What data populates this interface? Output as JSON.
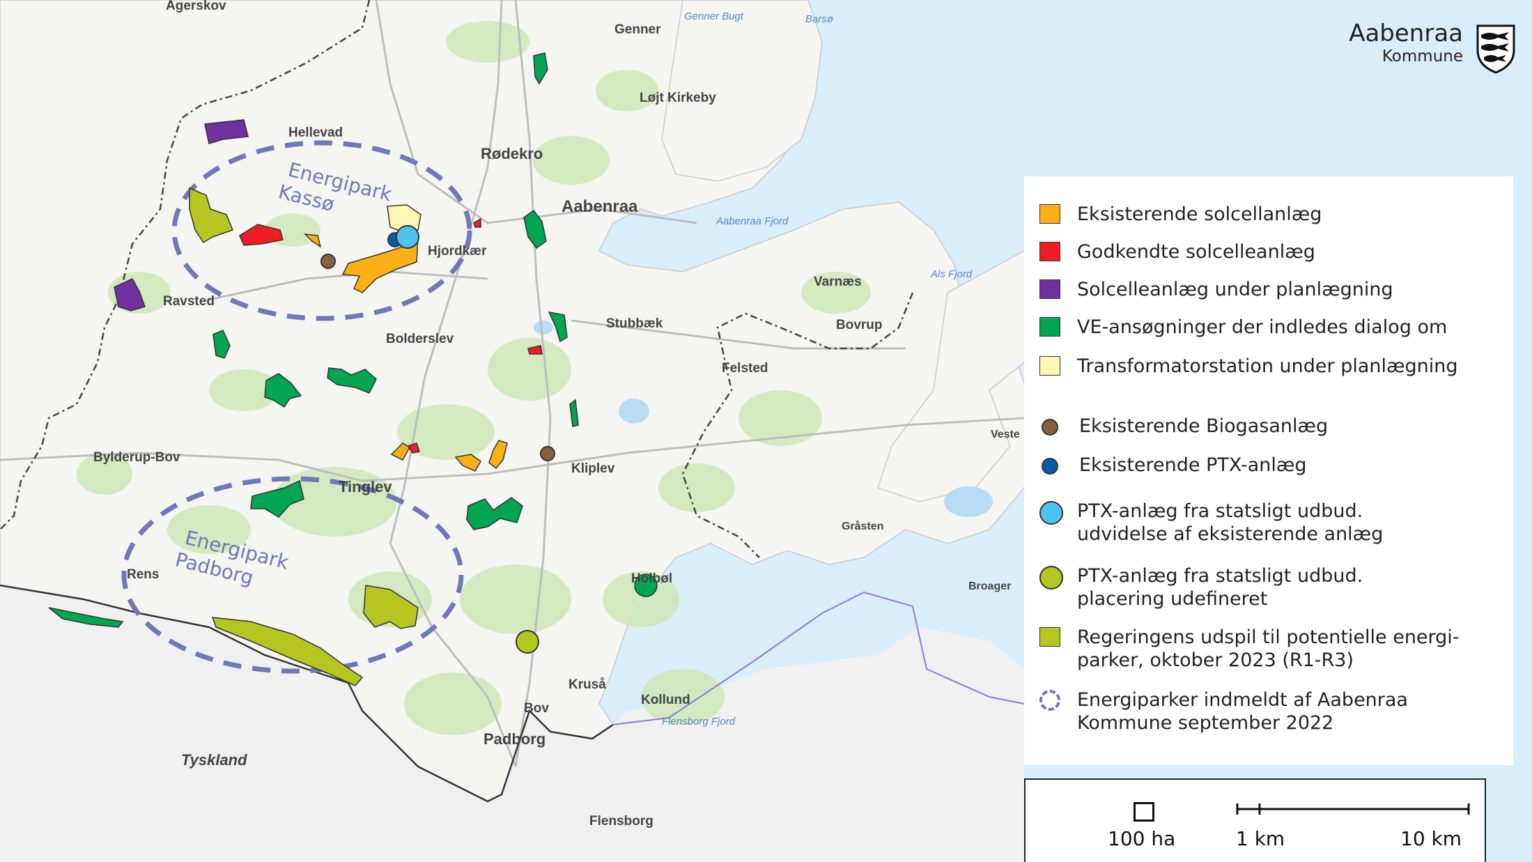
{
  "map": {
    "country_label": "Tyskland",
    "places": [
      {
        "id": "agerskov",
        "name": "Agerskov"
      },
      {
        "id": "genner",
        "name": "Genner"
      },
      {
        "id": "hellevad",
        "name": "Hellevad"
      },
      {
        "id": "rodekro",
        "name": "Rødekro"
      },
      {
        "id": "lojt",
        "name": "Løjt Kirkeby"
      },
      {
        "id": "aabenraa",
        "name": "Aabenraa"
      },
      {
        "id": "hjordkaer",
        "name": "Hjordkær"
      },
      {
        "id": "ravsted",
        "name": "Ravsted"
      },
      {
        "id": "boldersleu",
        "name": "Bolderslev"
      },
      {
        "id": "stubbaek",
        "name": "Stubbæk"
      },
      {
        "id": "varnaes",
        "name": "Varnæs"
      },
      {
        "id": "bovrup",
        "name": "Bovrup"
      },
      {
        "id": "felsted",
        "name": "Felsted"
      },
      {
        "id": "bylderup",
        "name": "Bylderup-Bov"
      },
      {
        "id": "tinglev",
        "name": "Tinglev"
      },
      {
        "id": "kliplev",
        "name": "Kliplev"
      },
      {
        "id": "veste",
        "name": "Veste"
      },
      {
        "id": "grasten",
        "name": "Gråsten"
      },
      {
        "id": "rens",
        "name": "Rens"
      },
      {
        "id": "holbol",
        "name": "Holbøl"
      },
      {
        "id": "broager",
        "name": "Broager"
      },
      {
        "id": "krusaa",
        "name": "Kruså"
      },
      {
        "id": "kollund",
        "name": "Kollund"
      },
      {
        "id": "bov",
        "name": "Bov"
      },
      {
        "id": "padborg",
        "name": "Padborg"
      },
      {
        "id": "flensborg",
        "name": "Flensborg"
      }
    ],
    "waters": [
      {
        "id": "gennerbugt",
        "name": "Genner Bugt"
      },
      {
        "id": "barso",
        "name": "Barsø"
      },
      {
        "id": "aabenraafjord",
        "name": "Aabenraa Fjord"
      },
      {
        "id": "alsfjord",
        "name": "Als Fjord"
      },
      {
        "id": "flensborgfjord",
        "name": "Flensborg Fjord"
      }
    ],
    "energy_parks": [
      {
        "id": "kasso",
        "line1": "Energipark",
        "line2": "Kassø"
      },
      {
        "id": "padborg",
        "line1": "Energipark",
        "line2": "Padborg"
      }
    ]
  },
  "logo": {
    "name": "Aabenraa",
    "sub": "Kommune"
  },
  "legend": {
    "items": [
      {
        "kind": "square",
        "color": "#f9b016",
        "label": "Eksisterende solcellanlæg"
      },
      {
        "kind": "square",
        "color": "#ee1c24",
        "label": "Godkendte solcelleanlæg"
      },
      {
        "kind": "square",
        "color": "#7030a0",
        "label": "Solcelleanlæg under planlægning"
      },
      {
        "kind": "square",
        "color": "#00a651",
        "label": "VE-ansøgninger der indledes dialog om"
      },
      {
        "kind": "square",
        "color": "#fdf6b4",
        "label": "Transformatorstation under planlægning"
      },
      {
        "kind": "dot",
        "color": "#8b5e3c",
        "label": "Eksisterende Biogasanlæg"
      },
      {
        "kind": "dot",
        "color": "#0b5aa8",
        "label": "Eksisterende PTX-anlæg"
      },
      {
        "kind": "dot",
        "color": "#4fc3f0",
        "label": "PTX-anlæg fra statsligt udbud.\nudvidelse af eksisterende anlæg"
      },
      {
        "kind": "dot",
        "color": "#b5c621",
        "label": "PTX-anlæg fra statsligt udbud.\nplacering udefineret"
      },
      {
        "kind": "square",
        "color": "#b5c621",
        "label": "Regeringens udspil til potentielle energi-\nparker, oktober 2023 (R1-R3)"
      },
      {
        "kind": "ring",
        "color": "#6f78b8",
        "label": "Energiparker indmeldt af Aabenraa\nKommune september 2022"
      }
    ]
  },
  "scale": {
    "area_label": "100 ha",
    "small_label": "1 km",
    "large_label": "10 km"
  }
}
